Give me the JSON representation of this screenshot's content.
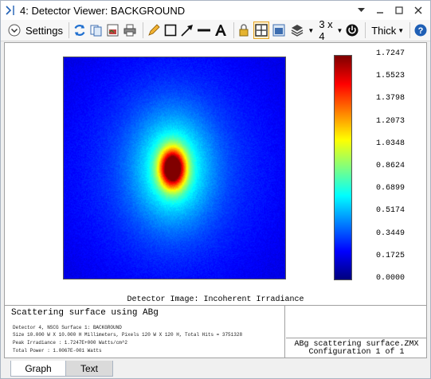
{
  "window": {
    "title": "4: Detector Viewer: BACKGROUND"
  },
  "toolbar": {
    "settings_label": "Settings",
    "layout_label": "3 x 4",
    "line_label": "Thick"
  },
  "chart_data": {
    "type": "heatmap",
    "title": "",
    "colorbar": {
      "ticks": [
        "1.7247",
        "1.5523",
        "1.3798",
        "1.2073",
        "1.0348",
        "0.8624",
        "0.6899",
        "0.5174",
        "0.3449",
        "0.1725",
        "0.0000"
      ],
      "min": 0.0,
      "max": 1.7247
    },
    "peak_value": 1.7247,
    "peak_position_fraction": {
      "x": 0.49,
      "y": 0.5
    },
    "grid": false
  },
  "plot": {
    "caption": "Detector Image: Incoherent Irradiance"
  },
  "info": {
    "title": "Scattering surface using ABg",
    "lines": [
      "Detector 4, NSCG Surface 1: BACKGROUND",
      "Size 10.000 W X 10.000 H Millimeters, Pixels 120 W X 120 H, Total Hits = 3751328",
      "Peak Irradiance : 1.7247E+000 Watts/cm^2",
      "Total Power     : 1.0067E-001 Watts"
    ],
    "file": "ABg scattering surface.ZMX",
    "config": "Configuration 1 of 1"
  },
  "tabs": [
    "Graph",
    "Text"
  ],
  "colors": {
    "accent": "#1f5fb5",
    "active_tool": "#e5a423"
  }
}
